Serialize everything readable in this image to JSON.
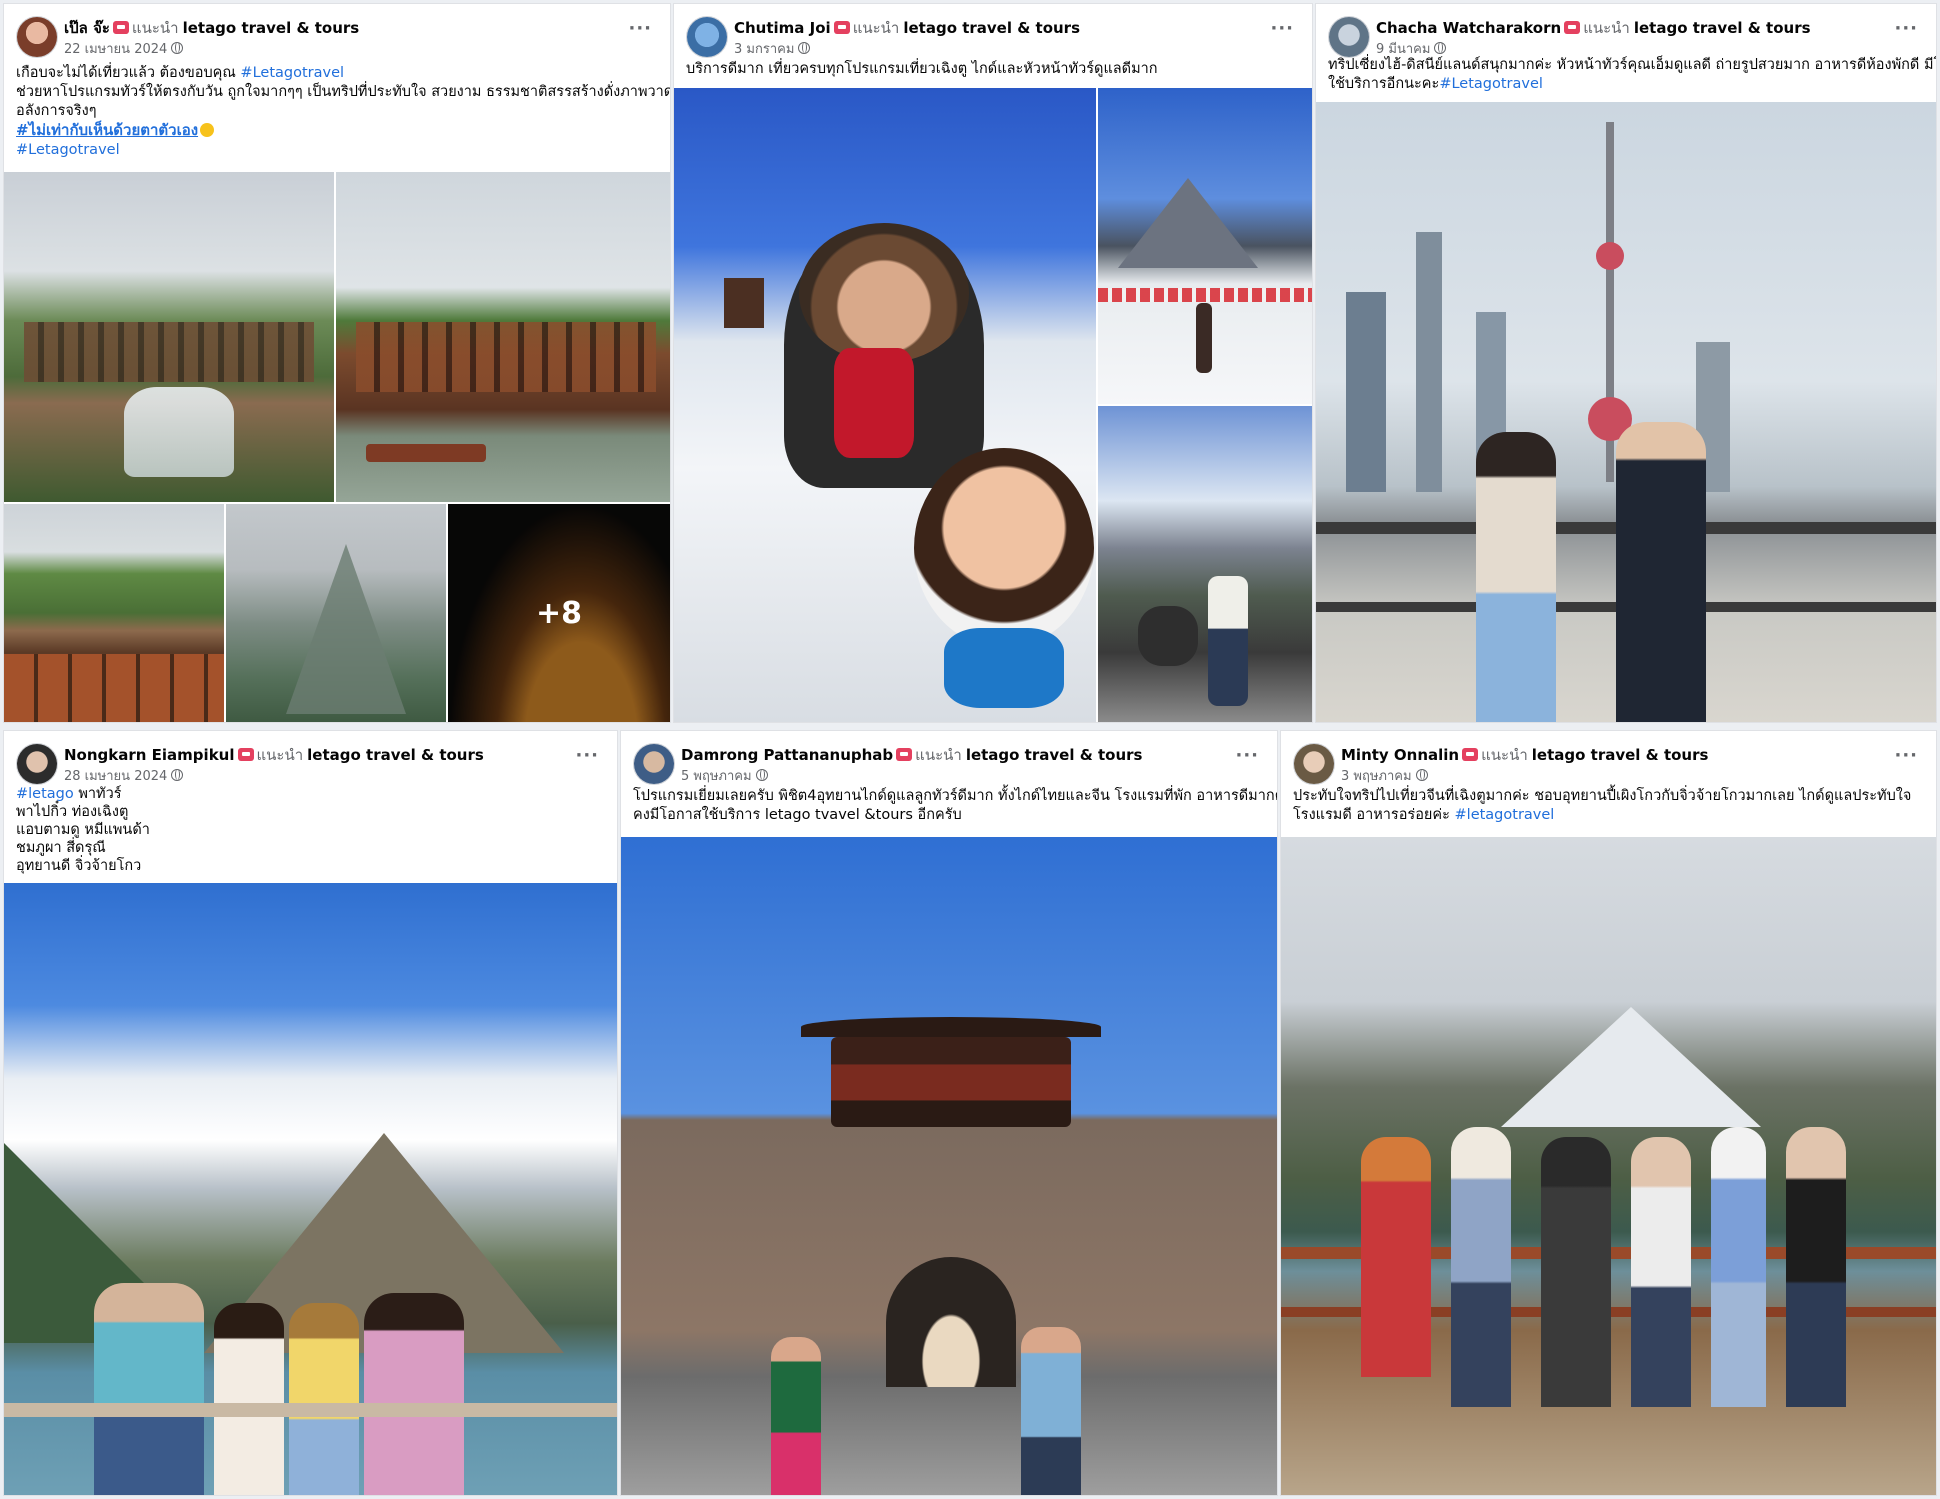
{
  "posts": [
    {
      "author": "เป๊ล จ๊ะ",
      "recommends": "แนะนำ",
      "page": "letago travel & tours",
      "date": "22 เมษายน 2024",
      "lines": [
        {
          "text": "เกือบจะไม่ได้เที่ยวแล้ว ต้องขอบคุณ ",
          "tag": "#Letagotravel"
        },
        {
          "text": "ช่วยหาโปรแกรมทัวร์ให้ตรงกับวัน ถูกใจมากๆๆ เป็นทริปที่ประทับใจ สวยงาม ธรรมชาติสรรสร้างดั่งภาพวาด"
        },
        {
          "text": "อลังการจริงๆ"
        },
        {
          "tag_ul": "#ไม่เท่ากับเห็นด้วยตาตัวเอง"
        },
        {
          "tag": "#Letagotravel"
        }
      ],
      "more_photos": "+8"
    },
    {
      "author": "Chutima Joi",
      "recommends": "แนะนำ",
      "page": "letago travel & tours",
      "date": "3 มกราคม",
      "lines": [
        {
          "text": "บริการดีมาก  เที่ยวครบทุกโปรแกรมเที่ยวเฉิงตู  ไกด์และหัวหน้าทัวร์ดูแลดีมาก"
        }
      ]
    },
    {
      "author": "Chacha Watcharakorn",
      "recommends": "แนะนำ",
      "page": "letago travel & tours",
      "date": "9 มีนาคม",
      "lines": [
        {
          "text": "ทริปเซี่ยงไฮ้-ดิสนีย์แลนด์สนุกมากค่ะ หัวหน้าทัวร์คุณเอ็มดูแลดี ถ่ายรูปสวยมาก อาหารดีห้องพักดี มีโอกาสจะ"
        },
        {
          "text": "ใช้บริการอีกนะคะ",
          "tag": "#Letagotravel"
        }
      ]
    },
    {
      "author": "Nongkarn Eiampikul",
      "recommends": "แนะนำ",
      "page": "letago travel & tours",
      "date": "28 เมษายน 2024",
      "lines": [
        {
          "tag": "#letago",
          "text": " พาทัวร์"
        },
        {
          "text": "พาไปกิ๋ว ท่องเฉิงตู"
        },
        {
          "text": "แอบตามดู หมีแพนด้า"
        },
        {
          "text": "ชมภูผา สี่ดรุณี"
        },
        {
          "text": "อุทยานดี จิ่วจ้ายโกว"
        }
      ]
    },
    {
      "author": "Damrong Pattananuphab",
      "recommends": "แนะนำ",
      "page": "letago travel & tours",
      "date": "5 พฤษภาคม",
      "lines": [
        {
          "text": "โปรแกรมเยี่ยมเลยครับ พิชิต4อุทยานไกด์ดูแลลูกทัวร์ดีมาก ทั้งไกด์ไทยและจีน โรงแรมที่พัก อาหารดีมากครับ"
        },
        {
          "text": "คงมีโอกาสใช้บริการ letago tvavel &tours อีกครับ"
        }
      ]
    },
    {
      "author": "Minty Onnalin",
      "recommends": "แนะนำ",
      "page": "letago travel & tours",
      "date": "3 พฤษภาคม",
      "lines": [
        {
          "text": "ประทับใจทริปไปเที่ยวจีนที่เฉิงตูมากค่ะ ชอบอุทยานปี้เผิงโกวกับจิ่วจ้ายโกวมากเลย ไกด์ดูแลประทับใจ"
        },
        {
          "text": "โรงแรมดี อาหารอร่อยค่ะ ",
          "tag": "#letagotravel"
        }
      ]
    }
  ],
  "colors": {
    "link": "#216fdb",
    "secondary_text": "#65676b",
    "badge": "#e4405f"
  }
}
